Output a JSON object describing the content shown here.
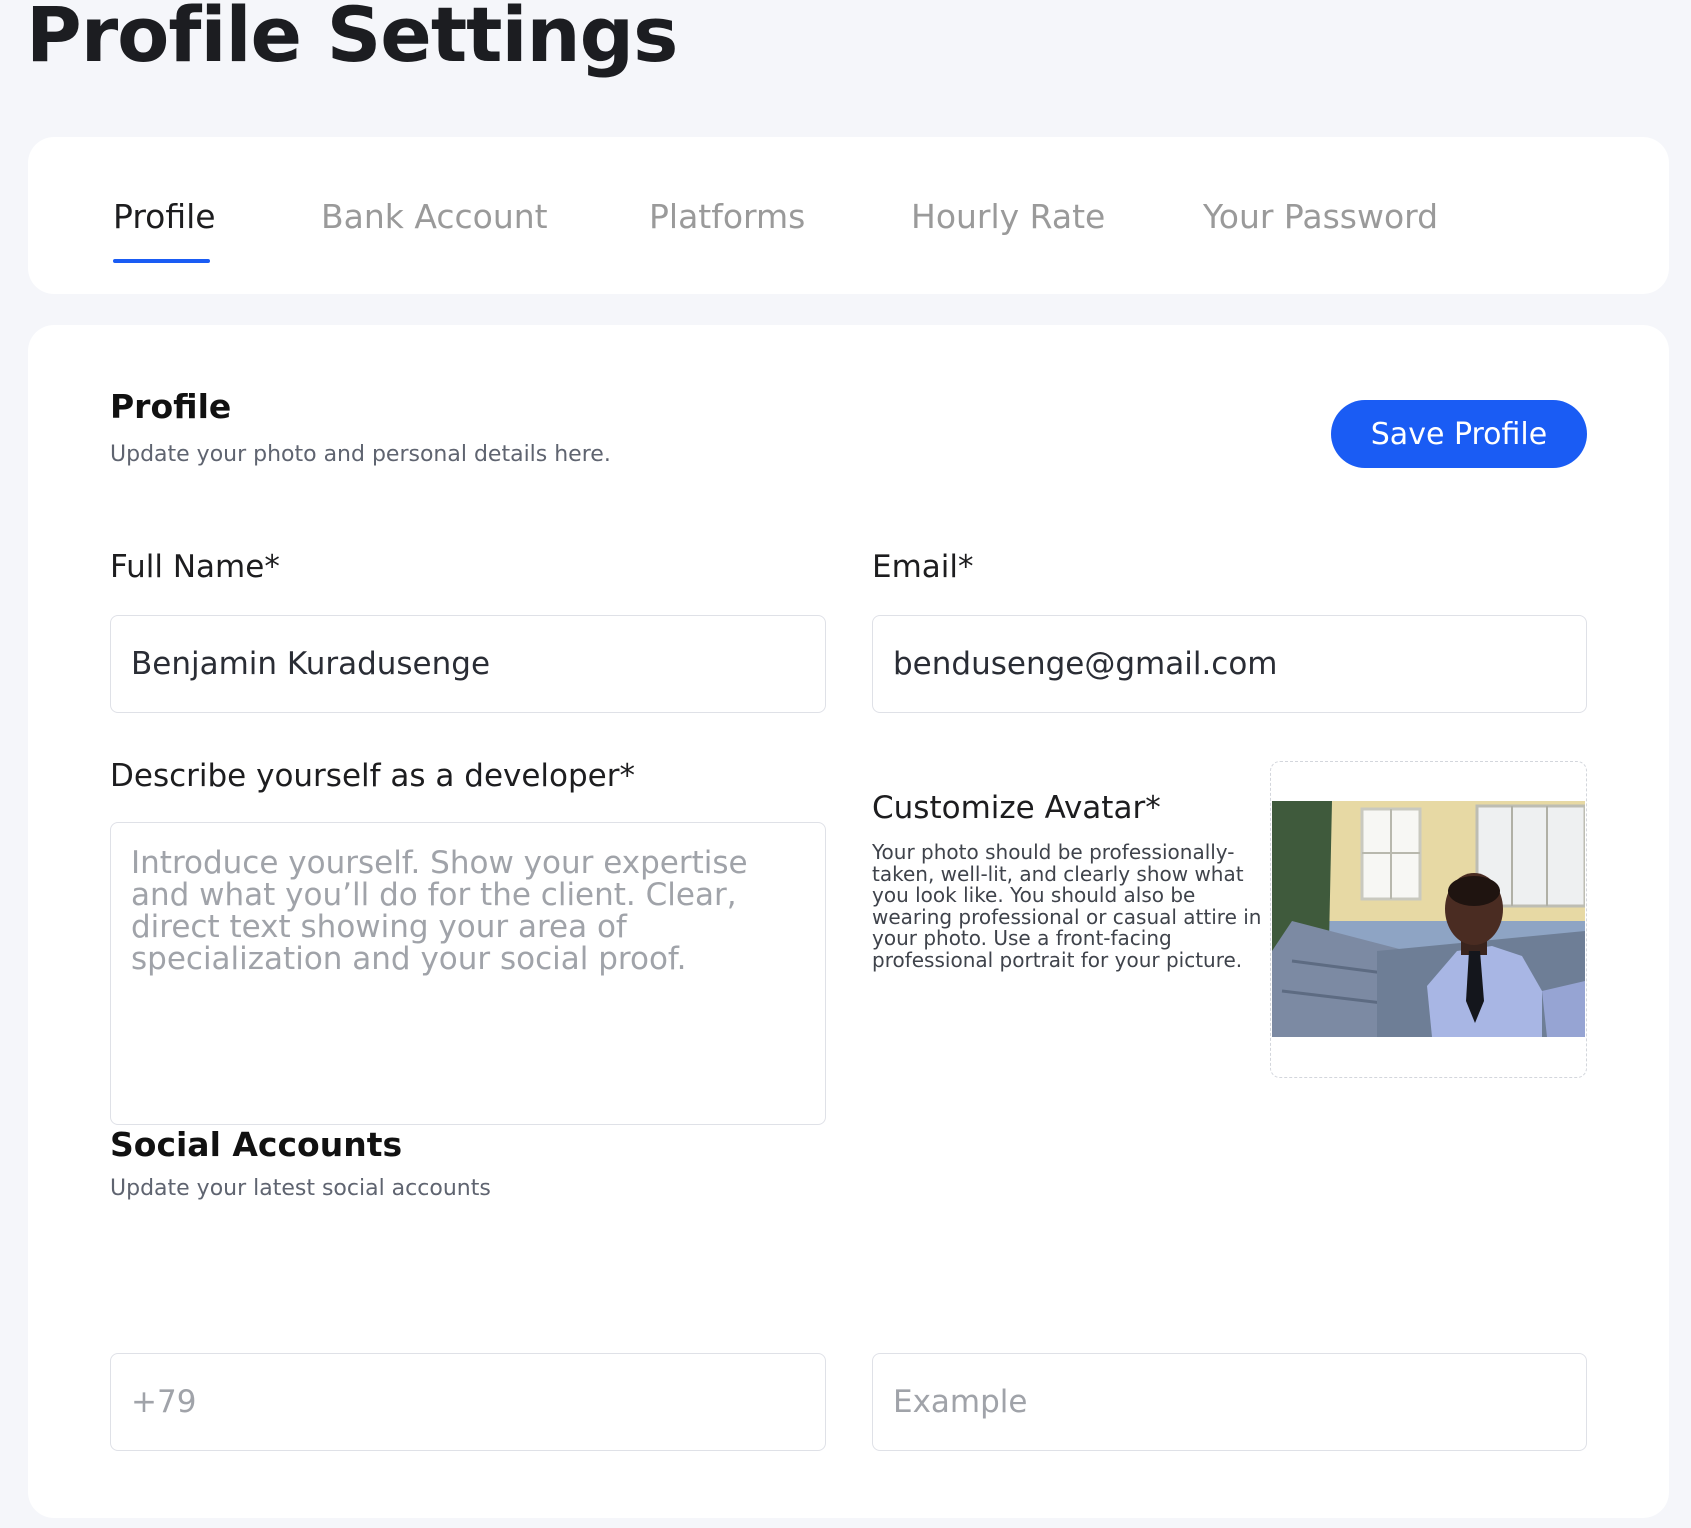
{
  "page": {
    "title": "Profile Settings"
  },
  "tabs": [
    {
      "label": "Profile",
      "active": true
    },
    {
      "label": "Bank Account",
      "active": false
    },
    {
      "label": "Platforms",
      "active": false
    },
    {
      "label": "Hourly Rate",
      "active": false
    },
    {
      "label": "Your Password",
      "active": false
    }
  ],
  "profile_section": {
    "title": "Profile",
    "subtitle": "Update your photo and personal details here.",
    "save_label": "Save Profile"
  },
  "form": {
    "full_name": {
      "label": "Full Name*",
      "value": "Benjamin Kuradusenge"
    },
    "email": {
      "label": "Email*",
      "value": "bendusenge@gmail.com"
    },
    "bio": {
      "label": "Describe yourself as a developer*",
      "placeholder": "Introduce yourself. Show your expertise and what you’ll do for the client. Clear, direct text showing your area of specialization and your social proof.",
      "value": ""
    },
    "avatar": {
      "label": "Customize Avatar*",
      "help": "Your photo should be professionally-taken, well-lit, and clearly show what you look like. You should also be wearing professional or casual attire in your photo. Use a front-facing professional portrait for your picture."
    }
  },
  "social_section": {
    "title": "Social Accounts",
    "subtitle": "Update your latest social accounts",
    "phone_placeholder": "+79",
    "example_placeholder": "Example"
  },
  "colors": {
    "accent": "#1a5cf4",
    "page_bg": "#f5f6fa",
    "card_bg": "#ffffff"
  }
}
